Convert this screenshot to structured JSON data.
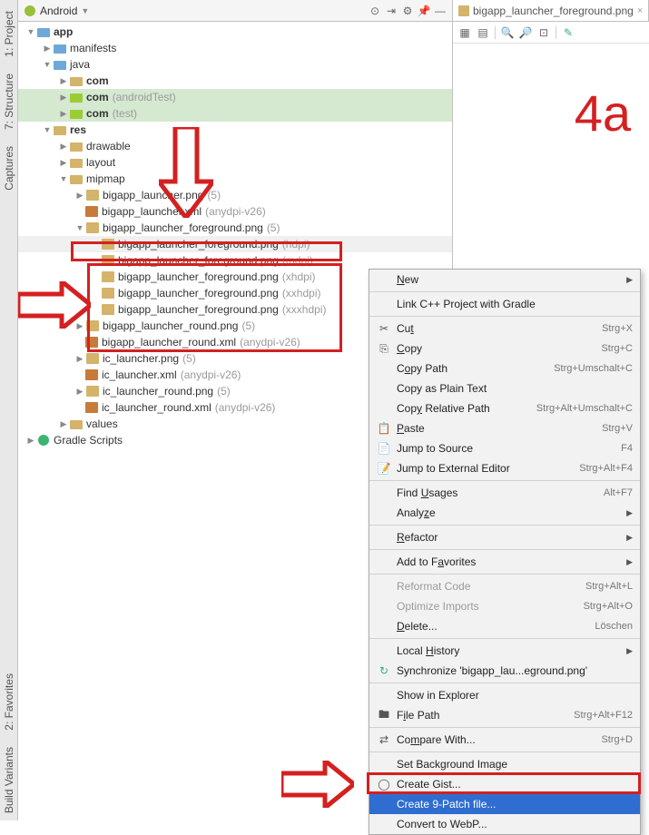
{
  "annotation": "4a",
  "side_tabs": {
    "project": "1: Project",
    "structure": "7: Structure",
    "captures": "Captures",
    "favorites": "2: Favorites",
    "build_variants": "Build Variants"
  },
  "project_header": {
    "title": "Android"
  },
  "tree": {
    "app": "app",
    "manifests": "manifests",
    "java": "java",
    "com1": "com",
    "com2": "com",
    "com2_suffix": "(androidTest)",
    "com3": "com",
    "com3_suffix": "(test)",
    "res": "res",
    "drawable": "drawable",
    "layout": "layout",
    "mipmap": "mipmap",
    "bigapp_launcher": "bigapp_launcher.png",
    "bigapp_launcher_suffix": "(5)",
    "bigapp_launcher_xml": "bigapp_launcher.xml",
    "bigapp_launcher_xml_suffix": "(anydpi-v26)",
    "bigapp_fg": "bigapp_launcher_foreground.png",
    "bigapp_fg_suffix": "(5)",
    "bigapp_fg_hdpi": "bigapp_launcher_foreground.png",
    "bigapp_fg_hdpi_suffix": "(hdpi)",
    "bigapp_fg_mdpi": "bigapp_launcher_foreground.png",
    "bigapp_fg_mdpi_suffix": "(mdpi)",
    "bigapp_fg_xhdpi": "bigapp_launcher_foreground.png",
    "bigapp_fg_xhdpi_suffix": "(xhdpi)",
    "bigapp_fg_xxhdpi": "bigapp_launcher_foreground.png",
    "bigapp_fg_xxhdpi_suffix": "(xxhdpi)",
    "bigapp_fg_xxxhdpi": "bigapp_launcher_foreground.png",
    "bigapp_fg_xxxhdpi_suffix": "(xxxhdpi)",
    "bigapp_round": "bigapp_launcher_round.png",
    "bigapp_round_suffix": "(5)",
    "bigapp_round_xml": "bigapp_launcher_round.xml",
    "bigapp_round_xml_suffix": "(anydpi-v26)",
    "ic_launcher": "ic_launcher.png",
    "ic_launcher_suffix": "(5)",
    "ic_launcher_xml": "ic_launcher.xml",
    "ic_launcher_xml_suffix": "(anydpi-v26)",
    "ic_launcher_round": "ic_launcher_round.png",
    "ic_launcher_round_suffix": "(5)",
    "ic_launcher_round_xml": "ic_launcher_round.xml",
    "ic_launcher_round_xml_suffix": "(anydpi-v26)",
    "values": "values",
    "gradle_scripts": "Gradle Scripts"
  },
  "editor": {
    "tab": "bigapp_launcher_foreground.png"
  },
  "menu": {
    "new": "New",
    "link_cpp": "Link C++ Project with Gradle",
    "cut": "Cut",
    "cut_sc": "Strg+X",
    "copy": "Copy",
    "copy_sc": "Strg+C",
    "copy_path": "Copy Path",
    "copy_path_sc": "Strg+Umschalt+C",
    "copy_plain": "Copy as Plain Text",
    "copy_rel": "Copy Relative Path",
    "copy_rel_sc": "Strg+Alt+Umschalt+C",
    "paste": "Paste",
    "paste_sc": "Strg+V",
    "jump_source": "Jump to Source",
    "jump_source_sc": "F4",
    "jump_ext": "Jump to External Editor",
    "jump_ext_sc": "Strg+Alt+F4",
    "find_usages": "Find Usages",
    "find_usages_sc": "Alt+F7",
    "analyze": "Analyze",
    "refactor": "Refactor",
    "add_fav": "Add to Favorites",
    "reformat": "Reformat Code",
    "reformat_sc": "Strg+Alt+L",
    "optimize": "Optimize Imports",
    "optimize_sc": "Strg+Alt+O",
    "delete": "Delete...",
    "delete_sc": "Löschen",
    "local_history": "Local History",
    "sync": "Synchronize 'bigapp_lau...eground.png'",
    "show_explorer": "Show in Explorer",
    "file_path": "File Path",
    "file_path_sc": "Strg+Alt+F12",
    "compare": "Compare With...",
    "compare_sc": "Strg+D",
    "set_bg": "Set Background Image",
    "create_gist": "Create Gist...",
    "create_9patch": "Create 9-Patch file...",
    "convert_webp": "Convert to WebP..."
  }
}
